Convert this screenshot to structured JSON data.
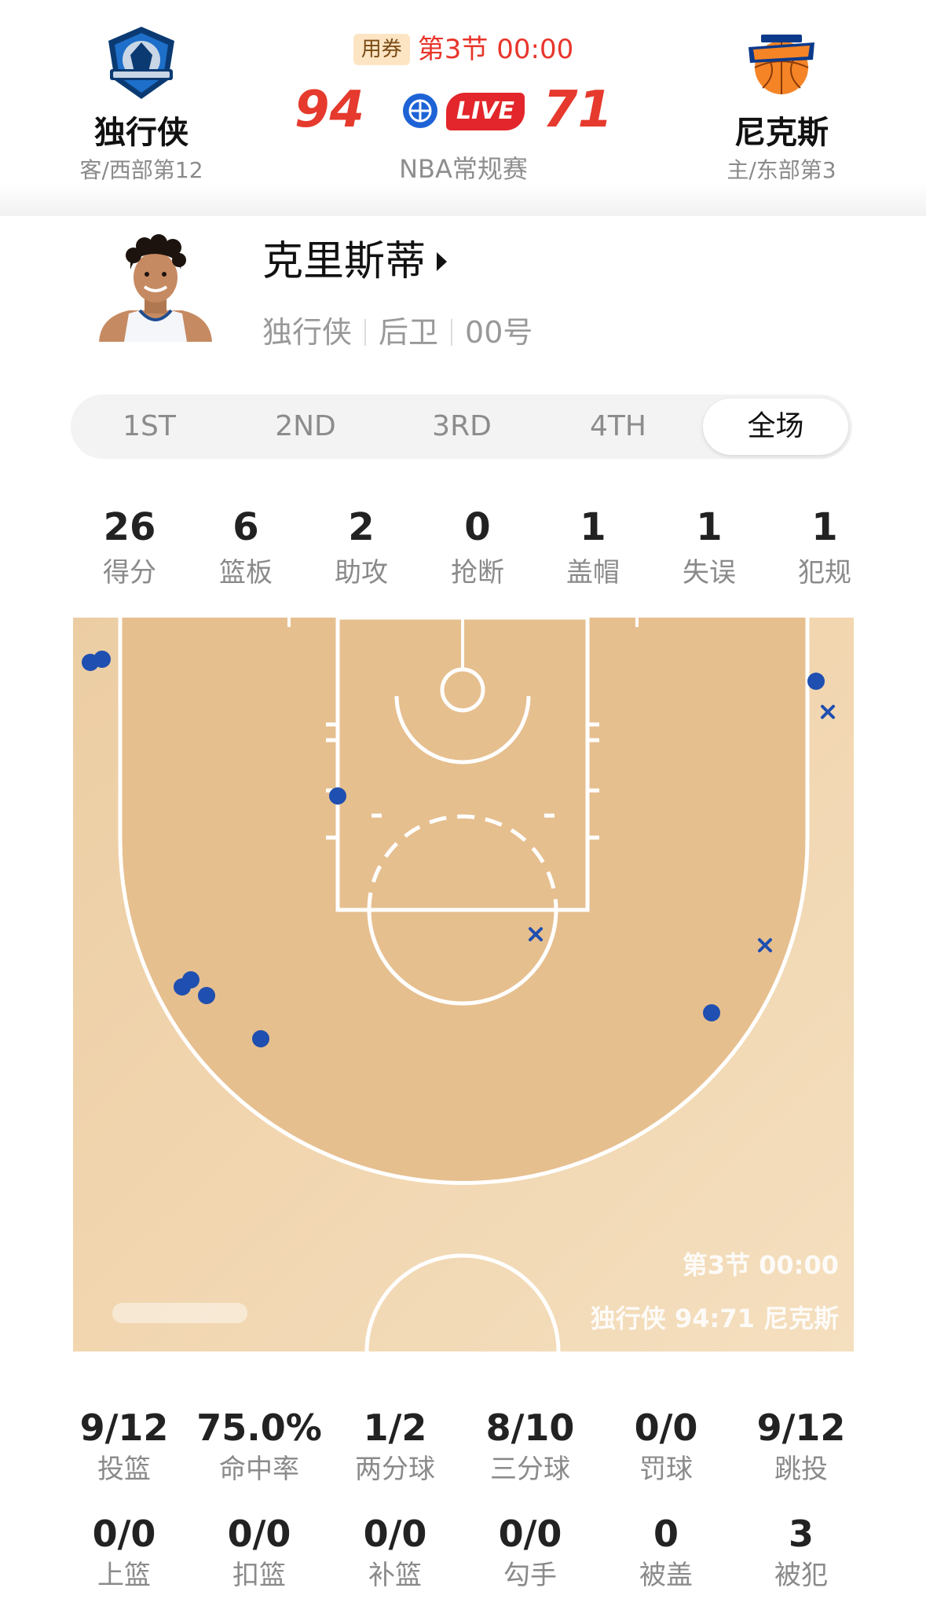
{
  "header": {
    "away": {
      "name": "独行侠",
      "rank": "客/西部第12",
      "logo_icon": "mavericks-logo-icon"
    },
    "home": {
      "name": "尼克斯",
      "rank": "主/东部第3",
      "logo_icon": "knicks-logo-icon"
    },
    "coupon": "用券",
    "period": "第3节 00:00",
    "away_score": "94",
    "home_score": "71",
    "live": "LIVE",
    "league": "NBA常规赛"
  },
  "player": {
    "name": "克里斯蒂",
    "team": "独行侠",
    "position": "后卫",
    "number": "00号"
  },
  "tabs": [
    {
      "label": "1ST",
      "active": false
    },
    {
      "label": "2ND",
      "active": false
    },
    {
      "label": "3RD",
      "active": false
    },
    {
      "label": "4TH",
      "active": false
    },
    {
      "label": "全场",
      "active": true
    }
  ],
  "stats_top": [
    {
      "value": "26",
      "label": "得分"
    },
    {
      "value": "6",
      "label": "篮板"
    },
    {
      "value": "2",
      "label": "助攻"
    },
    {
      "value": "0",
      "label": "抢断"
    },
    {
      "value": "1",
      "label": "盖帽"
    },
    {
      "value": "1",
      "label": "失误"
    },
    {
      "value": "1",
      "label": "犯规"
    }
  ],
  "court": {
    "period": "第3节 00:00",
    "score_line": "独行侠 94:71 尼克斯",
    "colors": {
      "made": "#1f4fb0",
      "missed": "#1f4fb0",
      "line": "#ffffff"
    }
  },
  "stats_bottom_row1": [
    {
      "value": "9/12",
      "label": "投篮"
    },
    {
      "value": "75.0%",
      "label": "命中率"
    },
    {
      "value": "1/2",
      "label": "两分球"
    },
    {
      "value": "8/10",
      "label": "三分球"
    },
    {
      "value": "0/0",
      "label": "罚球"
    },
    {
      "value": "9/12",
      "label": "跳投"
    }
  ],
  "stats_bottom_row2": [
    {
      "value": "0/0",
      "label": "上篮"
    },
    {
      "value": "0/0",
      "label": "扣篮"
    },
    {
      "value": "0/0",
      "label": "补篮"
    },
    {
      "value": "0/0",
      "label": "勾手"
    },
    {
      "value": "0",
      "label": "被盖"
    },
    {
      "value": "3",
      "label": "被犯"
    }
  ]
}
